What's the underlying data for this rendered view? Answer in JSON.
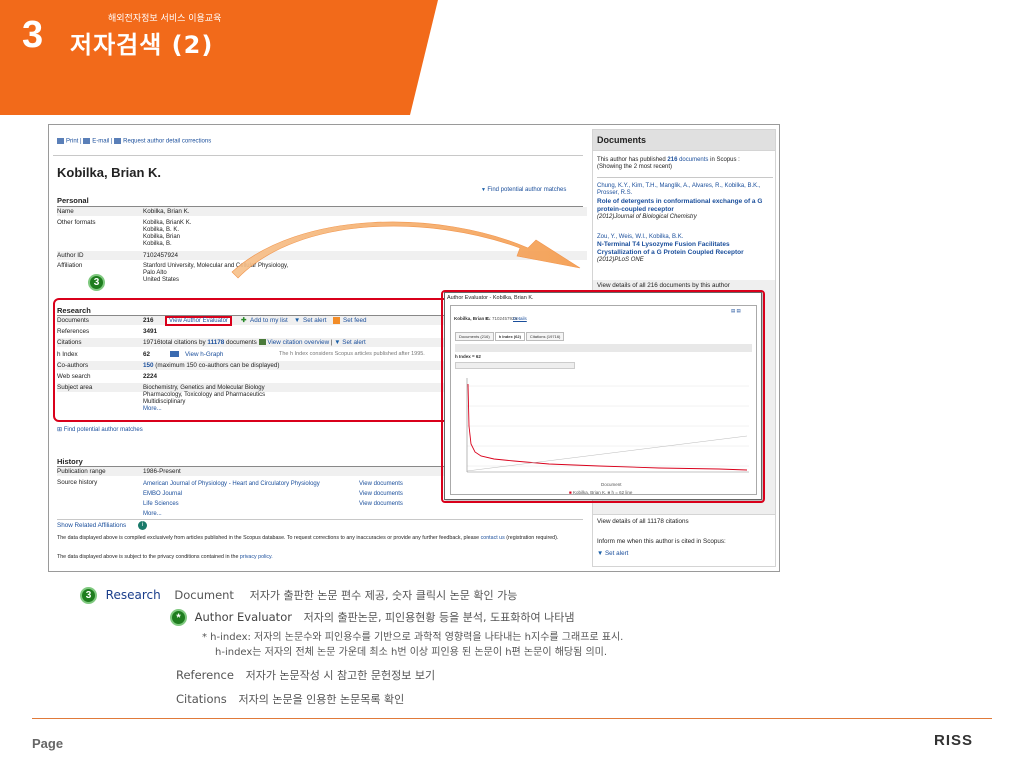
{
  "slide": {
    "number": "3",
    "subtitle": "해외전자정보 서비스 이용교육",
    "title": "저자검색 (2)",
    "page_label": "Page",
    "logo": "RISS",
    "colors": {
      "banner": "#f26a1a",
      "accent": "#d9001b",
      "link": "#1a4e9b"
    }
  },
  "scopus": {
    "topbar": {
      "print": "Print",
      "email": "E-mail",
      "request": "Request author detail corrections"
    },
    "author_name": "Kobilka, Brian K.",
    "find_matches": "Find potential author matches",
    "personal": {
      "heading": "Personal",
      "name_label": "Name",
      "name_value": "Kobilka, Brian K.",
      "other_label": "Other formats",
      "other_values": [
        "Kobilka, BrianK K.",
        "Kobilka, B. K.",
        "Kobilka, Brian",
        "Kobilka, B."
      ],
      "id_label": "Author ID",
      "id_value": "7102457924",
      "aff_label": "Affiliation",
      "aff_values": [
        "Stanford University, Molecular and Cellular Physiology,",
        "Palo Alto",
        "United States"
      ]
    },
    "research": {
      "heading": "Research",
      "documents_label": "Documents",
      "documents_value": "216",
      "view_evaluator": "View Author Evaluator",
      "add_list": "Add to my list",
      "set_alert": "Set alert",
      "set_feed": "Set feed",
      "references_label": "References",
      "references_value": "3491",
      "citations_label": "Citations",
      "citations_text_a": "19716total citations by",
      "citations_docs": "11178",
      "citations_text_b": "documents",
      "citation_overview": "View citation overview",
      "citation_alert": "Set alert",
      "hindex_label": "h Index",
      "hindex_value": "62",
      "hgraph": "View h-Graph",
      "hindex_note": "The h Index considers Scopus articles published after 1995.",
      "coauthors_label": "Co-authors",
      "coauthors_value": "150",
      "coauthors_note": "(maximum 150 co-authors can be displayed)",
      "web_label": "Web search",
      "web_value": "2224",
      "subject_label": "Subject area",
      "subject_values": [
        "Biochemistry, Genetics and Molecular Biology",
        "Pharmacology, Toxicology and Pharmaceutics",
        "Multidisciplinary"
      ],
      "more": "More..."
    },
    "find_matches_bottom": "Find potential author matches",
    "history": {
      "heading": "History",
      "range_label": "Publication range",
      "range_value": "1986-Present",
      "source_label": "Source history",
      "sources": [
        "American Journal of Physiology - Heart and Circulatory Physiology",
        "EMBO Journal",
        "Life Sciences"
      ],
      "view_docs": "View documents",
      "more": "More..."
    },
    "show_related": "Show Related Affiliations",
    "footer1": "The data displayed above is compiled exclusively from articles published in the Scopus database. To request corrections to any inaccuracies or provide any further feedback, please",
    "footer1_link": "contact us",
    "footer1_tail": "(registration required).",
    "footer2": "The data displayed above is subject to the privacy conditions contained in the",
    "footer2_link": "privacy policy."
  },
  "documents_panel": {
    "heading": "Documents",
    "intro_a": "This author has published",
    "intro_count": "216",
    "intro_docs": "documents",
    "intro_b": "in Scopus :",
    "intro_c": "(Showing the 2 most recent)",
    "doc1_authors": "Chung, K.Y., Kim, T.H., Manglik, A., Alvares, R., Kobilka, B.K., Prosser, R.S.",
    "doc1_title": "Role of detergents in conformational exchange of a G protein-coupled receptor",
    "doc1_source": "(2012)Journal of Biological Chemistry",
    "doc2_authors": "Zou, Y., Weis, W.I., Kobilka, B.K.",
    "doc2_title": "N-Terminal T4 Lysozyme Fusion Facilitates Crystallization of a G Protein Coupled Receptor",
    "doc2_source": "(2012)PLoS ONE",
    "view_all": "View details of all 216 documents by this author",
    "view_citations": "View details of all 11178 citations",
    "inform": "Inform me when this author is cited in Scopus:",
    "set_alert": "Set alert"
  },
  "popup": {
    "title": "Author Evaluator - Kobilka, Brian K.",
    "author_line": "Kobilka, Brian K.",
    "id_line": "ID: 7102457924",
    "details": "Details",
    "tabs": [
      "Documents (216)",
      "h Index (62)",
      "Citations (19716)"
    ],
    "hindex_label": "h Index = 62",
    "xlabel": "Document",
    "legend_a": "Kobilka, Brian K.",
    "legend_b": "h = 62 line"
  },
  "explanations": {
    "research_label": "Research",
    "document_label": "Document",
    "document_text": "저자가 출판한 논문 편수 제공, 숫자 클릭시 논문 확인 가능",
    "star": "*",
    "evaluator_label": "Author Evaluator",
    "evaluator_text": "저자의 출판논문, 피인용현황 등을 분석, 도표화하여 나타냄",
    "hindex_note1": "* h-index: 저자의 논문수와 피인용수를 기반으로 과학적 영향력을 나타내는 h지수를 그래프로 표시.",
    "hindex_note2": "h-index는 저자의 전체 논문 가운데 최소 h번 이상 피인용 된 논문이 h편 논문이 해당됨 의미.",
    "reference_label": "Reference",
    "reference_text": "저자가 논문작성 시 참고한 문헌정보 보기",
    "citations_label": "Citations",
    "citations_text": "저자의 논문을 인용한 논문목록 확인"
  }
}
